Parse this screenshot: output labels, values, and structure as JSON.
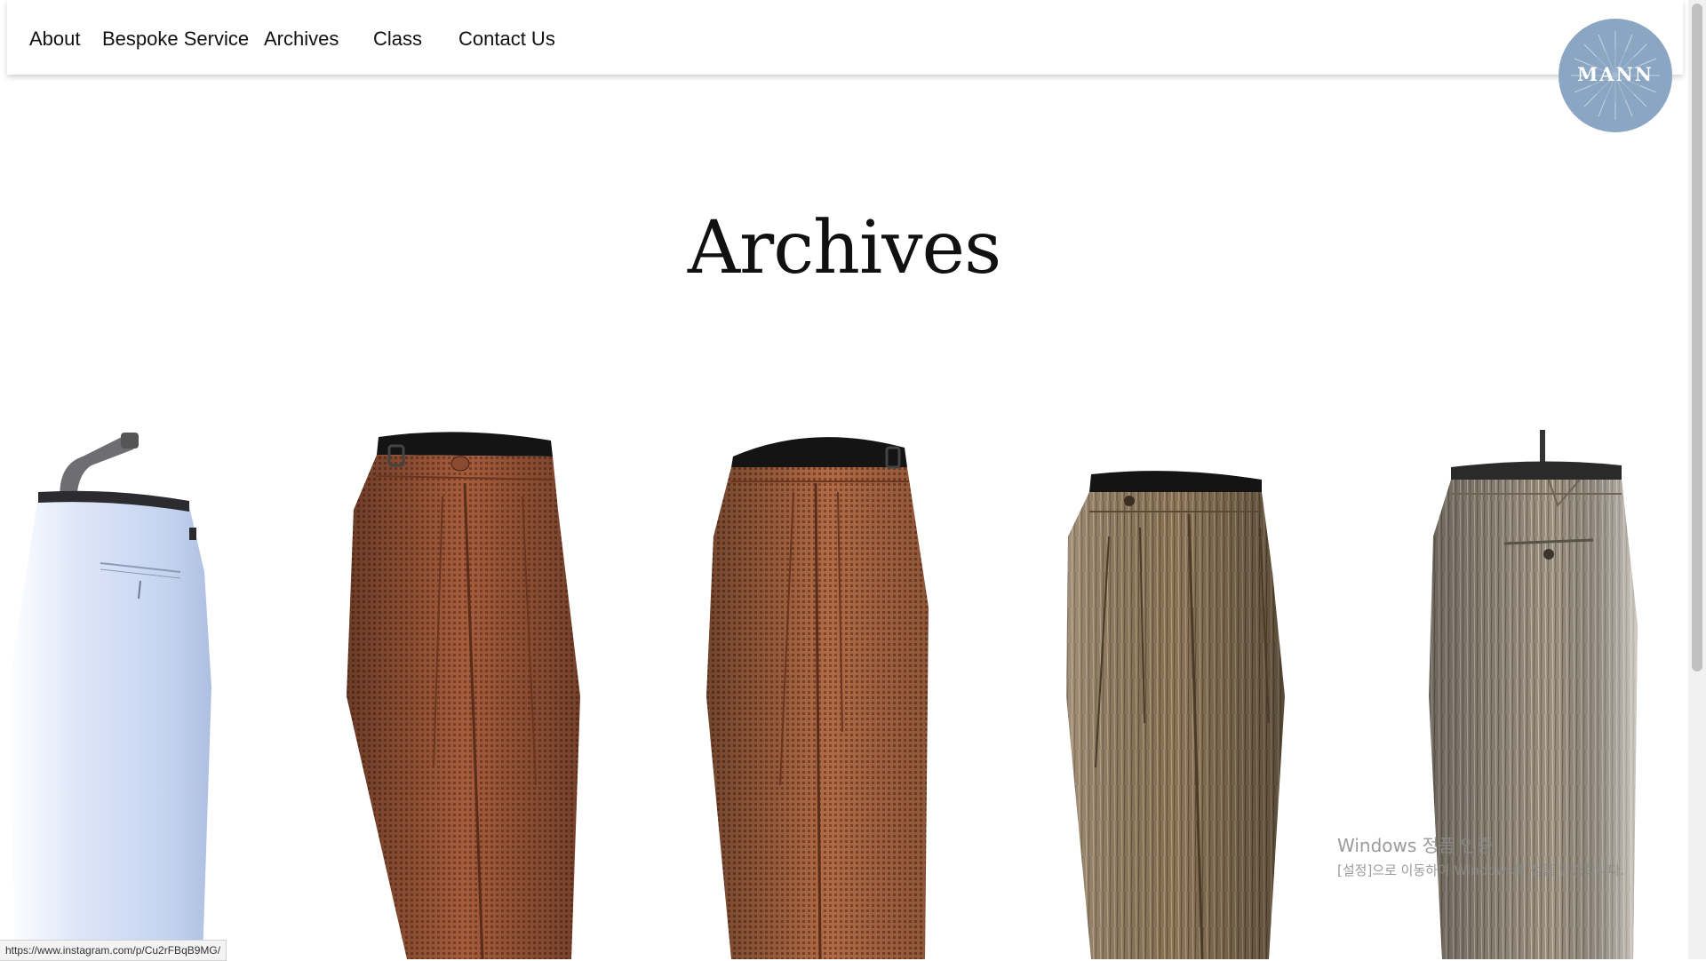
{
  "nav": {
    "items": [
      {
        "label": "About"
      },
      {
        "label": "Bespoke Service"
      },
      {
        "label": "Archives"
      },
      {
        "label": "Class"
      },
      {
        "label": "Contact Us"
      }
    ]
  },
  "logo": {
    "text": "MANN"
  },
  "page": {
    "title": "Archives"
  },
  "gallery": {
    "items": [
      {
        "name": "light-blue-trousers-back-view"
      },
      {
        "name": "brown-houndstooth-trousers-front-view"
      },
      {
        "name": "brown-houndstooth-trousers-front-view-2"
      },
      {
        "name": "brown-linen-trousers-front-view"
      },
      {
        "name": "tan-linen-trousers-back-view"
      }
    ]
  },
  "watermark": {
    "title": "Windows 정품 인증",
    "subtitle": "[설정]으로 이동하여 Windows를 정품 인증합니다."
  },
  "status_bar": {
    "url": "https://www.instagram.com/p/Cu2rFBqB9MG/"
  },
  "colors": {
    "logo_bg": "#8ba6c3",
    "light_blue_fabric": "#c5d4f0",
    "brown_fabric": "#a0573a",
    "linen_fabric": "#8a7458",
    "tan_fabric": "#9b9182"
  }
}
